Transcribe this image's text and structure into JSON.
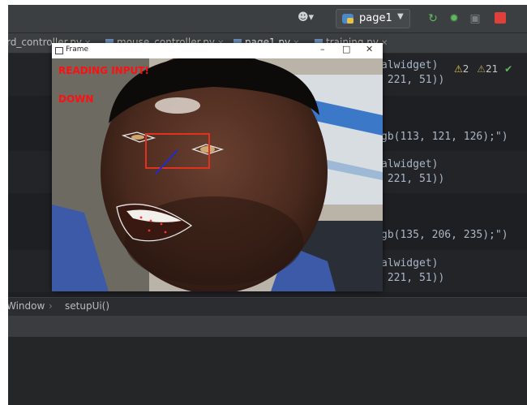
{
  "toolbar": {
    "run_config": "page1"
  },
  "tabs": [
    {
      "label": "rd_controller.py"
    },
    {
      "label": "mouse_controller.py"
    },
    {
      "label": "page1.py"
    },
    {
      "label": "training.py"
    }
  ],
  "inspections": {
    "warnings_a": "2",
    "warnings_b": "21"
  },
  "code_lines": [
    {
      "text": "alwidget)"
    },
    {
      "text": " 221, 51))"
    },
    {
      "text": "gb(113, 121, 126);\")"
    },
    {
      "text": "alwidget)"
    },
    {
      "text": " 221, 51))"
    },
    {
      "text": "gb(135, 206, 235);\")"
    },
    {
      "text": "alwidget)"
    },
    {
      "text": " 221, 51))"
    }
  ],
  "breadcrumb": {
    "class_part": "Window",
    "method_part": "setupUi()"
  },
  "frame_window": {
    "title": "Frame",
    "overlay_line1": "READING INPUT!",
    "overlay_line2": "DOWN"
  },
  "colors": {
    "ide_bg": "#1e1f22",
    "overlay_text": "#ff1010",
    "eye_box": "#e0321e",
    "direction_line": "#1a2cd8",
    "landmark_outline": "#e6e6e6"
  }
}
